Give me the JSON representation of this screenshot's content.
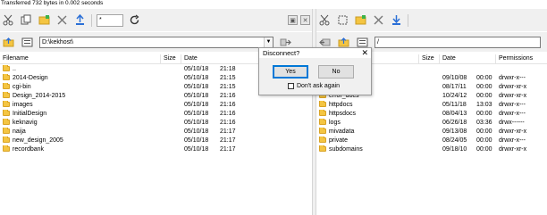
{
  "status_line": "Transferred 732 bytes in 0.002 seconds",
  "toolbar": {
    "left_icons": [
      "cut-icon",
      "copy-icon",
      "new-folder-icon",
      "delete-icon",
      "upload-icon"
    ],
    "filter_value": "*",
    "refresh_icon": "refresh-icon"
  },
  "local": {
    "path": "D:\\kekhost\\",
    "columns": [
      "Filename",
      "Size",
      "Date"
    ],
    "rows": [
      {
        "name": "..",
        "size": "",
        "date": "05/10/18",
        "time": "21:18"
      },
      {
        "name": "2014-Design",
        "size": "",
        "date": "05/10/18",
        "time": "21:15"
      },
      {
        "name": "cgi-bin",
        "size": "",
        "date": "05/10/18",
        "time": "21:15"
      },
      {
        "name": "Design_2014-2015",
        "size": "",
        "date": "05/10/18",
        "time": "21:16"
      },
      {
        "name": "images",
        "size": "",
        "date": "05/10/18",
        "time": "21:16"
      },
      {
        "name": "InitialDesign",
        "size": "",
        "date": "05/10/18",
        "time": "21:16"
      },
      {
        "name": "keknavig",
        "size": "",
        "date": "05/10/18",
        "time": "21:16"
      },
      {
        "name": "naija",
        "size": "",
        "date": "05/10/18",
        "time": "21:17"
      },
      {
        "name": "new_design_2005",
        "size": "",
        "date": "05/10/18",
        "time": "21:17"
      },
      {
        "name": "recordbank",
        "size": "",
        "date": "05/10/18",
        "time": "21:17"
      }
    ]
  },
  "remote": {
    "path": "/",
    "columns": [
      "Filename",
      "Size",
      "Date",
      "Permissions"
    ],
    "rows": [
      {
        "name": "",
        "size": "",
        "date": "",
        "time": "",
        "perm": ""
      },
      {
        "name": "",
        "size": "",
        "date": "09/10/08",
        "time": "00:00",
        "perm": "drwxr-x---"
      },
      {
        "name": "",
        "size": "",
        "date": "08/17/11",
        "time": "00:00",
        "perm": "drwxr-xr-x"
      },
      {
        "name": "error_docs",
        "size": "",
        "date": "10/24/12",
        "time": "00:00",
        "perm": "drwxr-xr-x"
      },
      {
        "name": "httpdocs",
        "size": "",
        "date": "05/11/18",
        "time": "13:03",
        "perm": "drwxr-x---"
      },
      {
        "name": "httpsdocs",
        "size": "",
        "date": "08/04/13",
        "time": "00:00",
        "perm": "drwxr-x---"
      },
      {
        "name": "logs",
        "size": "",
        "date": "06/26/18",
        "time": "03:36",
        "perm": "drwx------"
      },
      {
        "name": "mivadata",
        "size": "",
        "date": "09/13/08",
        "time": "00:00",
        "perm": "drwxr-xr-x"
      },
      {
        "name": "private",
        "size": "",
        "date": "08/24/05",
        "time": "00:00",
        "perm": "drwxr-x---"
      },
      {
        "name": "subdomains",
        "size": "",
        "date": "09/18/10",
        "time": "00:00",
        "perm": "drwxr-xr-x"
      }
    ]
  },
  "dialog": {
    "title": "Disconnect?",
    "yes": "Yes",
    "no": "No",
    "dont_ask": "Don't ask again"
  }
}
